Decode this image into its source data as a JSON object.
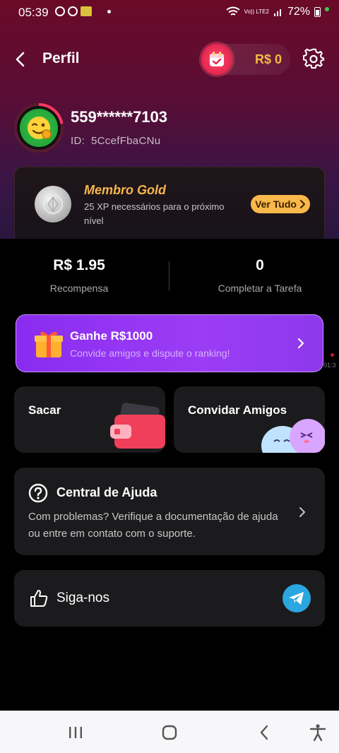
{
  "status_bar": {
    "time": "05:39",
    "battery": "72%",
    "network": "Vo)) LTE2"
  },
  "header": {
    "title": "Perfil",
    "wallet_amount": "R$ 0"
  },
  "profile": {
    "username": "559******7103",
    "id_label": "ID:",
    "id_value": "5CcefFbaCNu"
  },
  "membership": {
    "title": "Membro Gold",
    "description": "25 XP necessários para o próximo nível",
    "button_label": "Ver Tudo"
  },
  "stats": [
    {
      "value": "R$ 1.95",
      "label": "Recompensa"
    },
    {
      "value": "0",
      "label": "Completar a Tarefa"
    }
  ],
  "invite_banner": {
    "title": "Ganhe R$1000",
    "subtitle": "Convide amigos e dispute o ranking!"
  },
  "side_overlay": {
    "time": "01:3"
  },
  "actions": {
    "withdraw_label": "Sacar",
    "invite_label": "Convidar Amigos"
  },
  "help": {
    "title": "Central de Ajuda",
    "description": "Com problemas? Verifique a documentação de ajuda ou entre em contato com o suporte."
  },
  "follow": {
    "label": "Siga-nos"
  },
  "colors": {
    "accent_gold": "#f6b64a",
    "banner_purple": "#9b3df5",
    "wallet_red": "#e4264f",
    "telegram_blue": "#2aa7e0"
  }
}
